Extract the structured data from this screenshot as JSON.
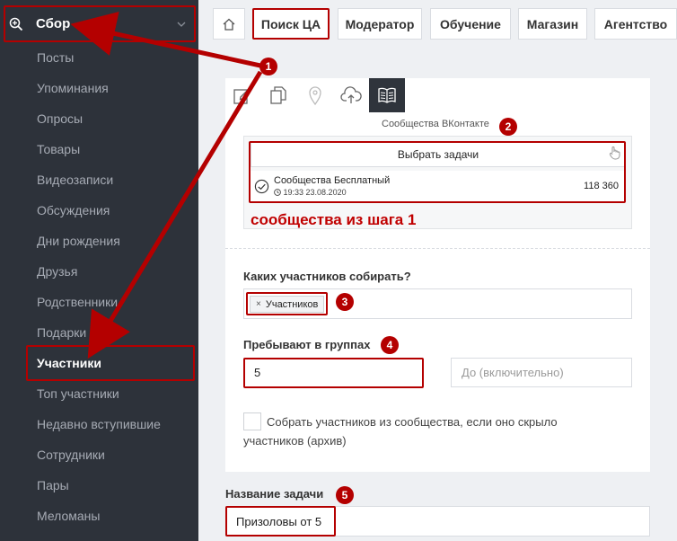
{
  "sidebar": {
    "header": {
      "icon": "zoom-in-icon",
      "label": "Сбор",
      "chevron": "chevron-down-icon"
    },
    "items": [
      {
        "label": "Посты"
      },
      {
        "label": "Упоминания"
      },
      {
        "label": "Опросы"
      },
      {
        "label": "Товары"
      },
      {
        "label": "Видеозаписи"
      },
      {
        "label": "Обсуждения"
      },
      {
        "label": "Дни рождения"
      },
      {
        "label": "Друзья"
      },
      {
        "label": "Родственники"
      },
      {
        "label": "Подарки"
      },
      {
        "label": "Участники",
        "active": true
      },
      {
        "label": "Топ участники"
      },
      {
        "label": "Недавно вступившие"
      },
      {
        "label": "Сотрудники"
      },
      {
        "label": "Пары"
      },
      {
        "label": "Меломаны"
      }
    ]
  },
  "tabs": {
    "home_icon": "home-icon",
    "items": [
      {
        "label": "Поиск ЦА"
      },
      {
        "label": "Модератор"
      },
      {
        "label": "Обучение"
      },
      {
        "label": "Магазин"
      },
      {
        "label": "Агентство"
      }
    ]
  },
  "toolbar": {
    "icons": [
      "edit-icon",
      "copy-icon",
      "map-pin-icon",
      "cloud-upload-icon",
      "book-icon"
    ]
  },
  "source": {
    "caption": "Сообщества ВКонтакте",
    "select_button": "Выбрать задачи",
    "entry": {
      "name": "Сообщества Бесплатный",
      "time": "19:33 23.08.2020",
      "count": "118 360"
    },
    "annotation": "сообщества из шага 1"
  },
  "form": {
    "members_label": "Каких участников собирать?",
    "members_tag": "Участников",
    "groups_label": "Пребывают в группах",
    "groups_from": "5",
    "groups_to_placeholder": "До (включительно)",
    "archive_checkbox_label": "Собрать участников из сообщества, если оно скрыло участников (архив)",
    "task_name_label": "Название задачи",
    "task_name_value": "Призоловы от 5"
  },
  "badges": [
    "1",
    "2",
    "3",
    "4",
    "5"
  ],
  "colors": {
    "annotation_red": "#b40000",
    "sidebar_bg": "#2d323a"
  }
}
